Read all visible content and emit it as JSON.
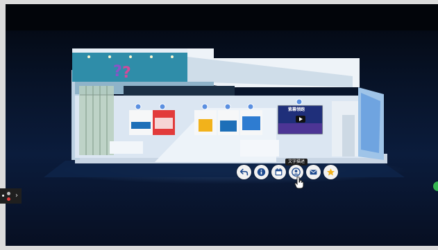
{
  "screen": {
    "video_title": "紫幕领跑",
    "tooltip": "文字描述"
  },
  "toolbar": {
    "buttons": [
      {
        "icon": "back-arrow-icon"
      },
      {
        "icon": "info-icon"
      },
      {
        "icon": "calendar-icon"
      },
      {
        "icon": "person-icon"
      },
      {
        "icon": "mail-icon"
      },
      {
        "icon": "star-icon"
      }
    ]
  },
  "colors": {
    "toolbar_button": "#f2f2f2",
    "toolbar_icon": "#1f4b8f",
    "star_icon": "#f2b21b",
    "hotspot": "#5a8fe0",
    "status_dot": "#34b550"
  }
}
